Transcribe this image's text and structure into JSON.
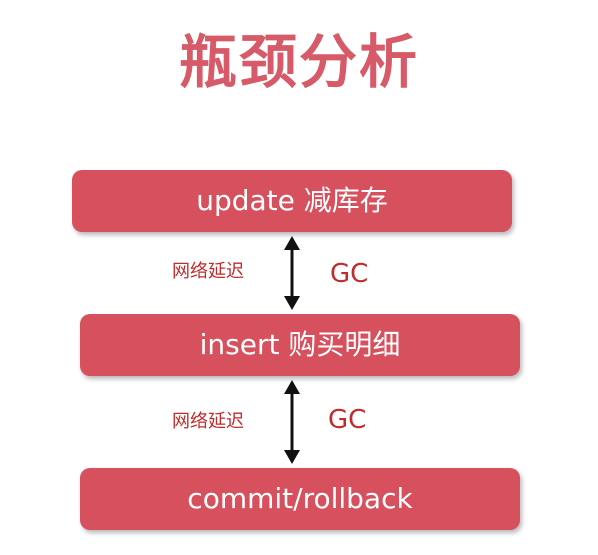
{
  "title": "瓶颈分析",
  "steps": [
    {
      "label": "update 减库存"
    },
    {
      "label": "insert 购买明细"
    },
    {
      "label": "commit/rollback"
    }
  ],
  "connectors": [
    {
      "latency_label": "网络延迟",
      "gc_label": "GC"
    },
    {
      "latency_label": "网络延迟",
      "gc_label": "GC"
    }
  ],
  "colors": {
    "title": "#d65a67",
    "box_fill": "#d6505e",
    "box_text": "#ffffff",
    "annotation_text": "#c22b2b",
    "arrow": "#111111"
  }
}
